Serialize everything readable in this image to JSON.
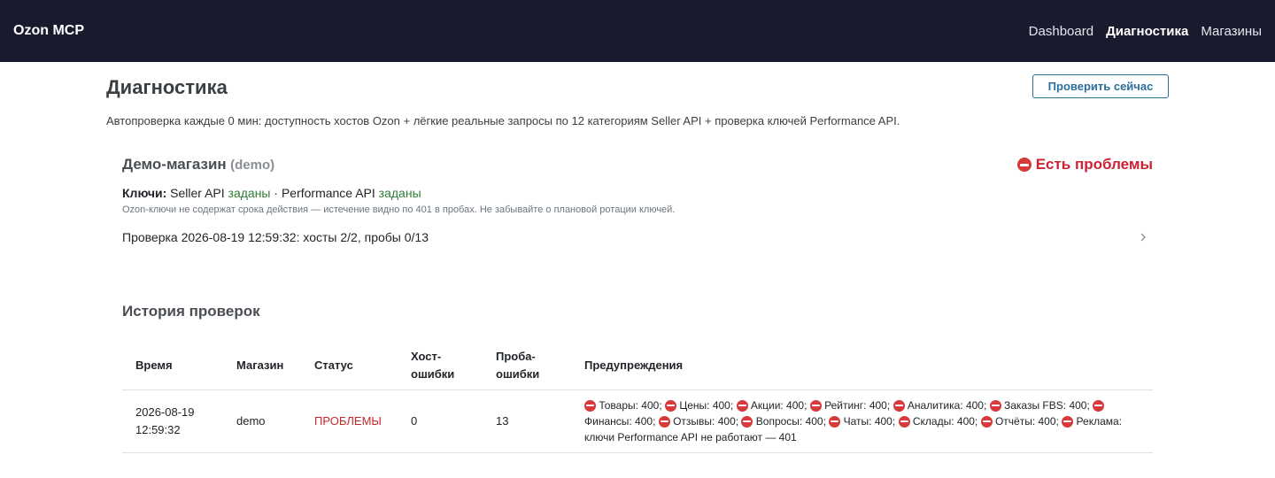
{
  "navbar": {
    "brand": "Ozon MCP",
    "links": [
      {
        "label": "Dashboard",
        "active": false
      },
      {
        "label": "Диагностика",
        "active": true
      },
      {
        "label": "Магазины",
        "active": false
      }
    ]
  },
  "page": {
    "title": "Диагностика",
    "check_button": "Проверить сейчас",
    "description": "Автопроверка каждые 0 мин: доступность хостов Ozon + лёгкие реальные запросы по 12 категориям Seller API + проверка ключей Performance API."
  },
  "shop_card": {
    "name": "Демо-магазин",
    "id_label": "(demo)",
    "status": "Есть проблемы",
    "keys_label": "Ключи:",
    "seller_api_label": "Seller API",
    "seller_api_state": "заданы",
    "separator": "·",
    "performance_api_label": "Performance API",
    "performance_api_state": "заданы",
    "keys_note": "Ozon-ключи не содержат срока действия — истечение видно по 401 в пробах. Не забывайте о плановой ротации ключей.",
    "check_summary": "Проверка 2026-08-19 12:59:32: хосты 2/2, пробы 0/13"
  },
  "history": {
    "title": "История проверок",
    "columns": [
      "Время",
      "Магазин",
      "Статус",
      "Хост-ошибки",
      "Проба-ошибки",
      "Предупреждения"
    ],
    "columns_split": [
      [
        "Время"
      ],
      [
        "Магазин"
      ],
      [
        "Статус"
      ],
      [
        "Хост-",
        "ошибки"
      ],
      [
        "Проба-",
        "ошибки"
      ],
      [
        "Предупреждения"
      ]
    ],
    "rows": [
      {
        "time_date": "2026-08-19",
        "time_clock": "12:59:32",
        "shop": "demo",
        "status": "ПРОБЛЕМЫ",
        "host_errors": "0",
        "probe_errors": "13",
        "warnings": [
          "Товары: 400;",
          "Цены: 400;",
          "Акции: 400;",
          "Рейтинг: 400;",
          "Аналитика: 400;",
          "Заказы FBS: 400;",
          "Финансы: 400;",
          "Отзывы: 400;",
          "Вопросы: 400;",
          "Чаты: 400;",
          "Склады: 400;",
          "Отчёты: 400;",
          "Реклама: ключи Performance API не работают — 401"
        ]
      }
    ]
  },
  "colors": {
    "navbar_bg": "#1a1a2e",
    "accent": "#2a6f9b",
    "problem": "#cc2233",
    "ok": "#2e7d32"
  },
  "icons": {
    "status": "no-entry-icon",
    "expand": "chevron-right-icon"
  }
}
